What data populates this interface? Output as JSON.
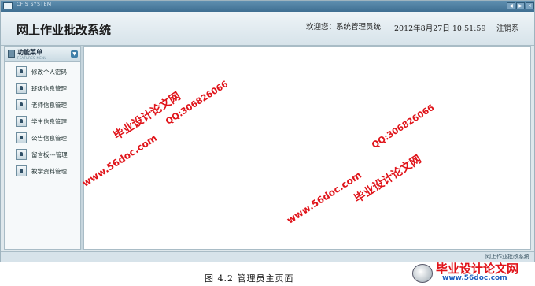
{
  "window": {
    "title_text": "CFIS SYSTEM"
  },
  "header": {
    "app_title": "网上作业批改系统",
    "welcome": "欢迎您：系统管理员统",
    "datetime": "2012年8月27日 10:51:59",
    "logout": "注销系"
  },
  "sidebar": {
    "title": "功能菜单",
    "subtitle": "FEATURES MENU",
    "items": [
      {
        "label": "修改个人密码"
      },
      {
        "label": "班级信息管理"
      },
      {
        "label": "老师信息管理"
      },
      {
        "label": "学生信息管理"
      },
      {
        "label": "公告信息管理"
      },
      {
        "label": "留言板---管理"
      },
      {
        "label": "教学资料管理"
      }
    ]
  },
  "statusbar": {
    "text": "网上作业批改系统"
  },
  "watermarks": {
    "cn": "毕业设计论文网",
    "url": "www.56doc.com",
    "qq": "QQ:306826066"
  },
  "caption": "图 4.2 管理员主页面",
  "stamp": {
    "cn": "毕业设计论文网",
    "url": "www.56doc.com"
  },
  "colors": {
    "watermark": "#e0141a",
    "stamp_url": "#1e5fbf",
    "header_bg": "#dfe8ec"
  }
}
